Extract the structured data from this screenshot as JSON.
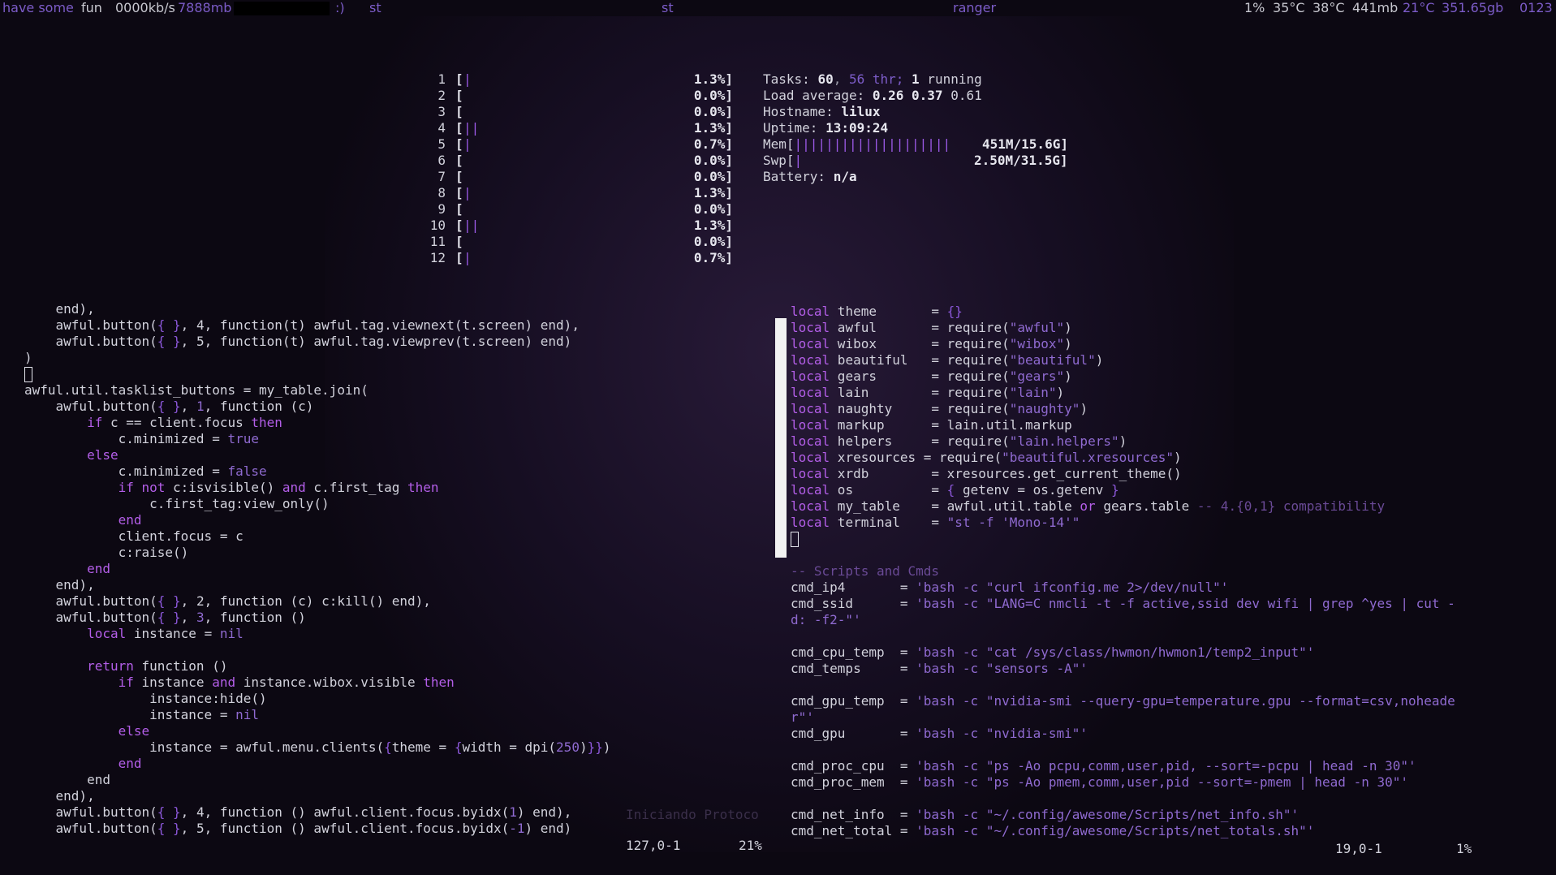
{
  "topbar": {
    "left_text_1": "have some",
    "left_text_2": "fun",
    "net_speed": "0000kb/s",
    "mem_used": "7888mb",
    "mood": ":)",
    "tag_1": "st",
    "title_center": "st",
    "title_app": "ranger",
    "cpu": "1%",
    "temp_1": "35°C",
    "temp_2": "38°C",
    "mem": "441mb",
    "weather": "21°C",
    "disk": "351.65gb",
    "clock": "0123"
  },
  "htop": {
    "cpus": [
      {
        "id": "1",
        "bars": "|",
        "pct": "1.3%]"
      },
      {
        "id": "2",
        "bars": "",
        "pct": "0.0%]"
      },
      {
        "id": "3",
        "bars": "",
        "pct": "0.0%]"
      },
      {
        "id": "4",
        "bars": "||",
        "pct": "1.3%]"
      },
      {
        "id": "5",
        "bars": "|",
        "pct": "0.7%]"
      },
      {
        "id": "6",
        "bars": "",
        "pct": "0.0%]"
      },
      {
        "id": "7",
        "bars": "",
        "pct": "0.0%]"
      },
      {
        "id": "8",
        "bars": "|",
        "pct": "1.3%]"
      },
      {
        "id": "9",
        "bars": "",
        "pct": "0.0%]"
      },
      {
        "id": "10",
        "bars": "||",
        "pct": "1.3%]"
      },
      {
        "id": "11",
        "bars": "",
        "pct": "0.0%]"
      },
      {
        "id": "12",
        "bars": "|",
        "pct": "0.7%]"
      }
    ],
    "tasks_label": "Tasks: ",
    "tasks": "60",
    "thr": "56",
    "thr_label": " thr; ",
    "running": "1",
    "running_label": " running",
    "load_label": "Load average: ",
    "load_1": "0.26 0.37",
    "load_15": " 0.61",
    "hostname_label": "Hostname: ",
    "hostname": "lilux",
    "uptime_label": "Uptime: ",
    "uptime": "13:09:24",
    "mem_label": "Mem[",
    "mem_bars": "||||||||||||||||||||",
    "mem_value": "451M/15.6G]",
    "swp_label": "Swp[",
    "swp_bars": "|",
    "swp_value": "2.50M/31.5G]",
    "battery_label": "Battery: ",
    "battery": "n/a"
  },
  "left_editor": {
    "status_pos": "127,0-1",
    "status_pct": "21%",
    "ghost_text": "Iniciando Protoco"
  },
  "right_editor": {
    "status_pos": "19,0-1",
    "status_pct": "1%"
  }
}
